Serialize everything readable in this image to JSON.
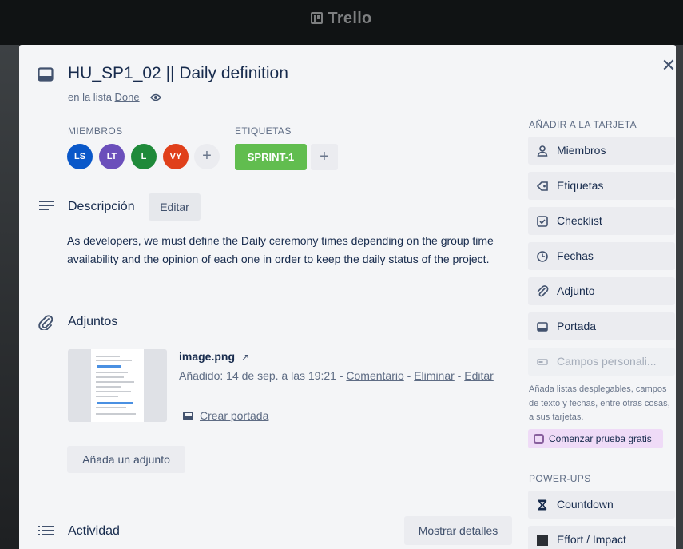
{
  "app": {
    "brand": "Trello"
  },
  "card": {
    "title": "HU_SP1_02 || Daily definition",
    "in_list_prefix": "en la lista",
    "list_name": "Done"
  },
  "members": {
    "label": "MIEMBROS",
    "items": [
      {
        "initials": "LS",
        "color": "#0a58c9"
      },
      {
        "initials": "LT",
        "color": "#6b4fbb"
      },
      {
        "initials": "L",
        "color": "#1f8a3a"
      },
      {
        "initials": "VY",
        "color": "#e0401b"
      }
    ],
    "add": "+"
  },
  "labels": {
    "label": "ETIQUETAS",
    "items": [
      {
        "text": "SPRINT-1",
        "color": "#61bd4f"
      }
    ],
    "add": "+"
  },
  "description": {
    "heading": "Descripción",
    "edit_label": "Editar",
    "text": "As developers, we must define the Daily ceremony times depending on the group time availability and the opinion of each one in order to keep the daily status of the project."
  },
  "attachments": {
    "heading": "Adjuntos",
    "items": [
      {
        "name": "image.png",
        "open_icon": "↗",
        "added": "Añadido: 14 de sep. a las 19:21",
        "sep": " - ",
        "comment": "Comentario",
        "delete": "Eliminar",
        "edit": "Editar",
        "make_cover": "Crear portada"
      }
    ],
    "add_label": "Añada un adjunto"
  },
  "activity": {
    "heading": "Actividad",
    "show_details": "Mostrar detalles"
  },
  "sidebar": {
    "add_to_card": "AÑADIR A LA TARJETA",
    "buttons": [
      {
        "label": "Miembros",
        "icon": "person-icon"
      },
      {
        "label": "Etiquetas",
        "icon": "tag-icon"
      },
      {
        "label": "Checklist",
        "icon": "checklist-icon"
      },
      {
        "label": "Fechas",
        "icon": "clock-icon"
      },
      {
        "label": "Adjunto",
        "icon": "paperclip-icon"
      },
      {
        "label": "Portada",
        "icon": "cover-icon"
      }
    ],
    "custom_fields": "Campos personali...",
    "custom_fields_note": "Añada listas desplegables, campos de texto y fechas, entre otras cosas, a sus tarjetas.",
    "trial_label": "Comenzar prueba gratis",
    "powerups_title": "POWER-UPS",
    "powerups": [
      {
        "label": "Countdown",
        "icon": "hourglass-icon"
      },
      {
        "label": "Effort / Impact",
        "icon": "square-icon"
      }
    ]
  },
  "colors": {
    "label_green": "#61bd4f",
    "trial_bg": "#efdbf7"
  }
}
